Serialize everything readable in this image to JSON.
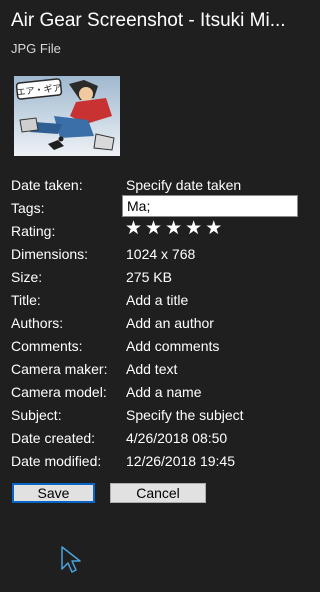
{
  "header": {
    "title": "Air Gear Screenshot - Itsuki Mi...",
    "file_type": "JPG File"
  },
  "thumbnail": {
    "logo_text": "エア・ギア"
  },
  "properties": {
    "date_taken": {
      "label": "Date taken:",
      "value": "Specify date taken"
    },
    "tags": {
      "label": "Tags:",
      "value": "Ma;"
    },
    "rating": {
      "label": "Rating:",
      "stars": 0,
      "max_stars": 5
    },
    "dimensions": {
      "label": "Dimensions:",
      "value": "1024 x 768"
    },
    "size": {
      "label": "Size:",
      "value": "275 KB"
    },
    "title": {
      "label": "Title:",
      "value": "Add a title"
    },
    "authors": {
      "label": "Authors:",
      "value": "Add an author"
    },
    "comments": {
      "label": "Comments:",
      "value": "Add comments"
    },
    "camera_maker": {
      "label": "Camera maker:",
      "value": "Add text"
    },
    "camera_model": {
      "label": "Camera model:",
      "value": "Add a name"
    },
    "subject": {
      "label": "Subject:",
      "value": "Specify the subject"
    },
    "date_created": {
      "label": "Date created:",
      "value": "4/26/2018 08:50"
    },
    "date_modified": {
      "label": "Date modified:",
      "value": "12/26/2018 19:45"
    }
  },
  "buttons": {
    "save_label": "Save",
    "cancel_label": "Cancel"
  },
  "colors": {
    "background": "#1f1f1f",
    "text": "#ffffff",
    "focus_border": "#0a64c8"
  }
}
